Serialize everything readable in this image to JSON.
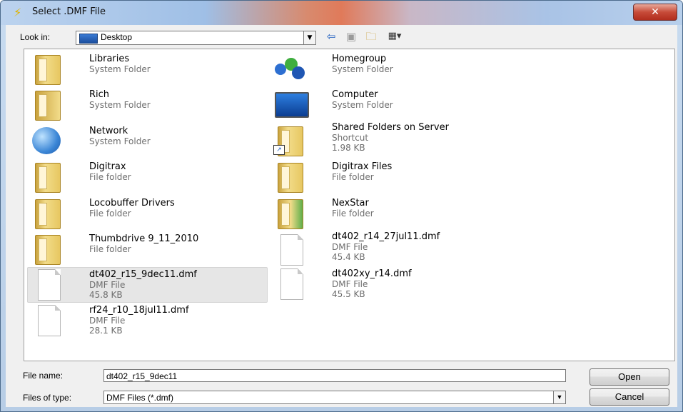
{
  "window": {
    "title": "Select .DMF File",
    "close_glyph": "✕"
  },
  "toolbar": {
    "look_in_label": "Look in:",
    "look_in_value": "Desktop",
    "icons": [
      "back-arrow-icon",
      "up-folder-icon",
      "new-folder-icon",
      "view-menu-icon"
    ]
  },
  "items_left": [
    {
      "name": "Libraries",
      "sub": "System Folder",
      "sub2": ""
    },
    {
      "name": "Rich",
      "sub": "System Folder",
      "sub2": ""
    },
    {
      "name": "Network",
      "sub": "System Folder",
      "sub2": ""
    },
    {
      "name": "Digitrax",
      "sub": "File folder",
      "sub2": ""
    },
    {
      "name": "Locobuffer Drivers",
      "sub": "File folder",
      "sub2": ""
    },
    {
      "name": "Thumbdrive 9_11_2010",
      "sub": "File folder",
      "sub2": ""
    },
    {
      "name": "dt402_r15_9dec11.dmf",
      "sub": "DMF File",
      "sub2": "45.8 KB"
    },
    {
      "name": "rf24_r10_18jul11.dmf",
      "sub": "DMF File",
      "sub2": "28.1 KB"
    }
  ],
  "items_right": [
    {
      "name": "Homegroup",
      "sub": "System Folder",
      "sub2": ""
    },
    {
      "name": "Computer",
      "sub": "System Folder",
      "sub2": ""
    },
    {
      "name": "Shared Folders on Server",
      "sub": "Shortcut",
      "sub2": "1.98 KB"
    },
    {
      "name": "Digitrax Files",
      "sub": "File folder",
      "sub2": ""
    },
    {
      "name": "NexStar",
      "sub": "File folder",
      "sub2": ""
    },
    {
      "name": "dt402_r14_27jul11.dmf",
      "sub": "DMF File",
      "sub2": "45.4 KB"
    },
    {
      "name": "dt402xy_r14.dmf",
      "sub": "DMF File",
      "sub2": "45.5 KB"
    }
  ],
  "footer": {
    "file_name_label": "File name:",
    "file_name_value": "dt402_r15_9dec11",
    "file_type_label": "Files of type:",
    "file_type_value": "DMF Files (*.dmf)",
    "open_label": "Open",
    "cancel_label": "Cancel"
  }
}
